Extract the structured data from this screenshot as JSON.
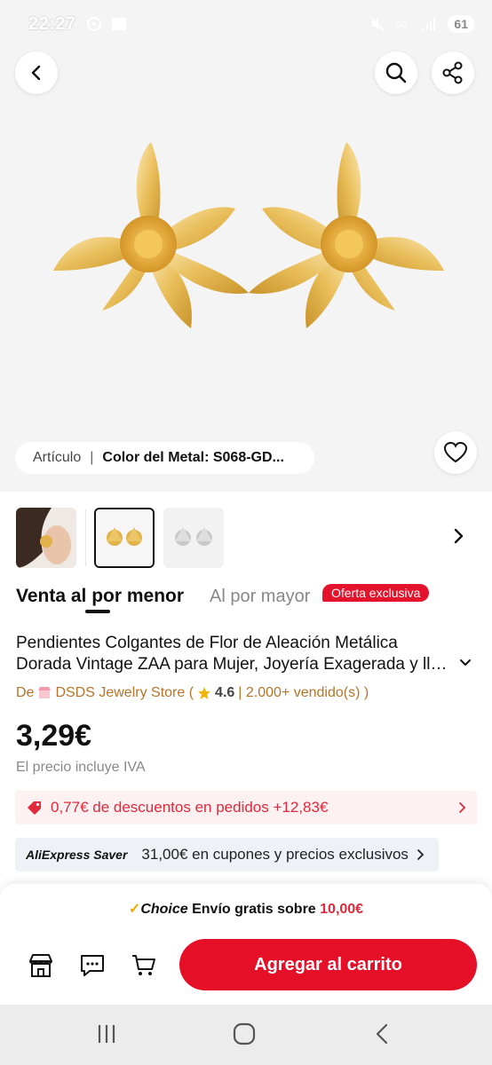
{
  "status_bar": {
    "time": "22:27",
    "battery": "61"
  },
  "hero": {
    "variant_label": "Artículo",
    "variant_separator": "|",
    "variant_value": "Color del Metal: S068-GD..."
  },
  "tabs": {
    "active_part1": "Venta al ",
    "active_part2": "por",
    "active_part3": " menor",
    "other": "Al por mayor",
    "badge": "Oferta exclusiva"
  },
  "product": {
    "title_line1": "Pendientes Colgantes de Flor de Aleación Metálica",
    "title_line2": "Dorada Vintage ZAA para Mujer, Joyería Exagerada y lla...",
    "store_prefix": "De",
    "store_name": "DSDS Jewelry Store (",
    "rating": "4.6",
    "sold": "| 2.000+ vendido(s) )",
    "price": "3,29€",
    "tax_note": "El precio incluye IVA"
  },
  "promos": {
    "discount_text": "0,77€ de descuentos en pedidos +12,83€",
    "saver_logo": "AliExpress Saver",
    "saver_text": "31,00€ en cupones y precios exclusivos"
  },
  "bottom": {
    "choice_logo": "Choice",
    "shipping_text": " Envío gratis sobre ",
    "shipping_amount": "10,00€",
    "cta": "Agregar al carrito"
  },
  "colors": {
    "accent": "#e60f28",
    "gold": "#e2b24a",
    "star": "#f2b200"
  }
}
